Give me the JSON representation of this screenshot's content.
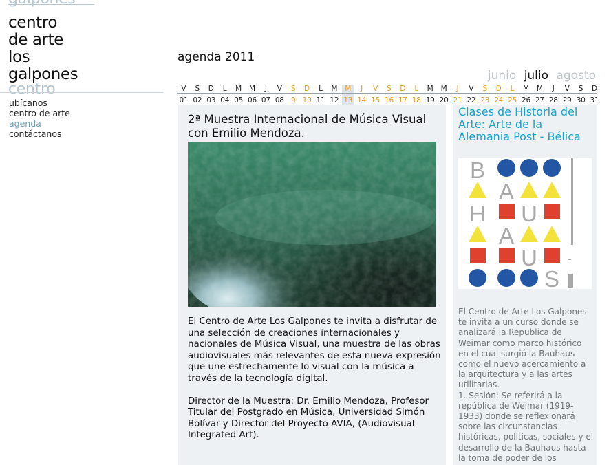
{
  "logo": {
    "ghost_top": "galpones",
    "lines": [
      "centro",
      "de arte",
      "los",
      "galpones"
    ],
    "ghost_bottom": "centro"
  },
  "nav": {
    "items": [
      {
        "label": "ubícanos",
        "active": false
      },
      {
        "label": "centro de arte",
        "active": false
      },
      {
        "label": "agenda",
        "active": true
      },
      {
        "label": "contáctanos",
        "active": false
      }
    ]
  },
  "agenda": {
    "title": "agenda 2011",
    "months": {
      "prev": "junio",
      "current": "julio",
      "next": "agosto"
    }
  },
  "calendar": {
    "highlight_day": "13",
    "days": [
      {
        "letter": "V",
        "num": "01",
        "weekend": false
      },
      {
        "letter": "S",
        "num": "02",
        "weekend": false
      },
      {
        "letter": "D",
        "num": "03",
        "weekend": false
      },
      {
        "letter": "L",
        "num": "04",
        "weekend": false
      },
      {
        "letter": "M",
        "num": "05",
        "weekend": false
      },
      {
        "letter": "M",
        "num": "06",
        "weekend": false
      },
      {
        "letter": "J",
        "num": "07",
        "weekend": false
      },
      {
        "letter": "V",
        "num": "08",
        "weekend": false
      },
      {
        "letter": "S",
        "num": "9",
        "weekend": true
      },
      {
        "letter": "D",
        "num": "10",
        "weekend": true
      },
      {
        "letter": "L",
        "num": "11",
        "weekend": false
      },
      {
        "letter": "M",
        "num": "12",
        "weekend": false
      },
      {
        "letter": "M",
        "num": "13",
        "weekend": true
      },
      {
        "letter": "J",
        "num": "14",
        "weekend": true
      },
      {
        "letter": "V",
        "num": "15",
        "weekend": true
      },
      {
        "letter": "S",
        "num": "16",
        "weekend": true
      },
      {
        "letter": "D",
        "num": "17",
        "weekend": true
      },
      {
        "letter": "L",
        "num": "18",
        "weekend": true
      },
      {
        "letter": "M",
        "num": "19",
        "weekend": false
      },
      {
        "letter": "M",
        "num": "20",
        "weekend": false
      },
      {
        "letter": "J",
        "num": "21",
        "weekend": true
      },
      {
        "letter": "V",
        "num": "22",
        "weekend": false
      },
      {
        "letter": "S",
        "num": "23",
        "weekend": true
      },
      {
        "letter": "D",
        "num": "24",
        "weekend": true
      },
      {
        "letter": "L",
        "num": "25",
        "weekend": true
      },
      {
        "letter": "M",
        "num": "26",
        "weekend": false
      },
      {
        "letter": "M",
        "num": "27",
        "weekend": false
      },
      {
        "letter": "J",
        "num": "28",
        "weekend": false
      },
      {
        "letter": "V",
        "num": "29",
        "weekend": false
      },
      {
        "letter": "S",
        "num": "30",
        "weekend": false
      },
      {
        "letter": "D",
        "num": "31",
        "weekend": false
      }
    ]
  },
  "main_event": {
    "title": "2ª Muestra Internacional de Música Visual con Emilio Mendoza.",
    "paragraphs": [
      "El Centro de Arte Los Galpones te invita a disfrutar de una selección de creaciones internacionales y nacionales de Música Visual, una muestra de las obras audiovisuales más relevantes de esta nueva expresión que une estrechamente lo visual con la música a través de la tecnología digital.",
      "Director de la Muestra: Dr. Emilio Mendoza, Profesor Titular del Postgrado en Música, Universidad Simón Bolívar y Director del Proyecto AVIA, (Audiovisual Integrated Art)."
    ]
  },
  "side_event": {
    "title": "Clases de Historia del Arte: Arte de la Alemania Post - Bélica",
    "bauhaus_letters": [
      "B",
      "A",
      "H",
      "U",
      "A",
      "U",
      "S"
    ],
    "paragraph1": "El Centro de Arte Los Galpones te invita a un curso donde se analizará la Republica de Weimar como marco histórico en el cual surgió la Bauhaus como el nuevo acercamiento a la arquitectura y a las artes utilitarias.",
    "paragraph2": "1. Sesión: Se referirá a la república de Weimar (1919-1933) donde se reflexionará sobre las circunstancias históricas, políticas, sociales y el desarrollo de la Bauhaus hasta la toma de poder de los"
  },
  "colors": {
    "accent_blue": "#1aa2cc",
    "nav_active": "#6e9fb4",
    "weekend_orange": "#e89a2a",
    "panel_bg": "#edf1f3",
    "bauhaus_blue": "#2456a6",
    "bauhaus_yellow": "#f2e23a",
    "bauhaus_red": "#e0402e",
    "bauhaus_grey": "#a9a9a9"
  }
}
